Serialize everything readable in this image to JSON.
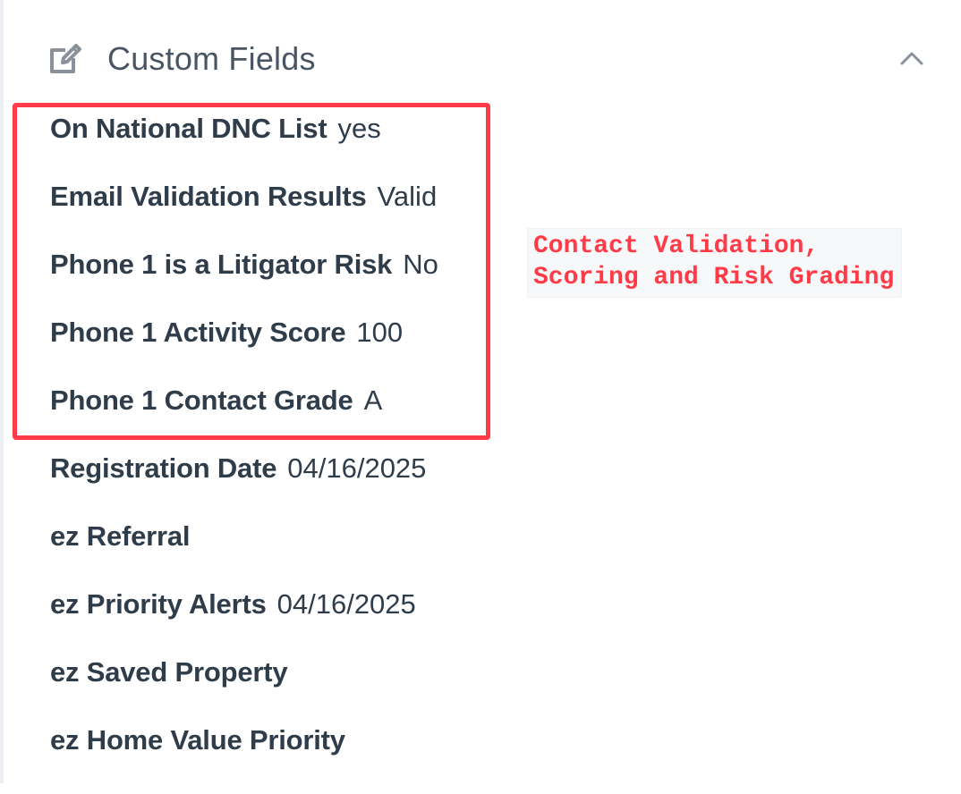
{
  "section": {
    "title": "Custom Fields",
    "header_icon": "edit-square-icon",
    "toggle_icon": "chevron-up-icon"
  },
  "fields": [
    {
      "label": "On National DNC List",
      "value": "yes"
    },
    {
      "label": "Email Validation Results",
      "value": "Valid"
    },
    {
      "label": "Phone 1 is a Litigator Risk",
      "value": "No"
    },
    {
      "label": "Phone 1 Activity Score",
      "value": "100"
    },
    {
      "label": "Phone 1 Contact Grade",
      "value": "A"
    },
    {
      "label": "Registration Date",
      "value": "04/16/2025"
    },
    {
      "label": "ez Referral",
      "value": ""
    },
    {
      "label": "ez Priority Alerts",
      "value": "04/16/2025"
    },
    {
      "label": "ez Saved Property",
      "value": ""
    },
    {
      "label": "ez Home Value Priority",
      "value": ""
    }
  ],
  "annotation": {
    "line1": "Contact Validation,",
    "line2": "Scoring and Risk Grading"
  },
  "colors": {
    "highlight": "#ff3b48",
    "text": "#2f3c4a",
    "muted": "#4a5563"
  }
}
